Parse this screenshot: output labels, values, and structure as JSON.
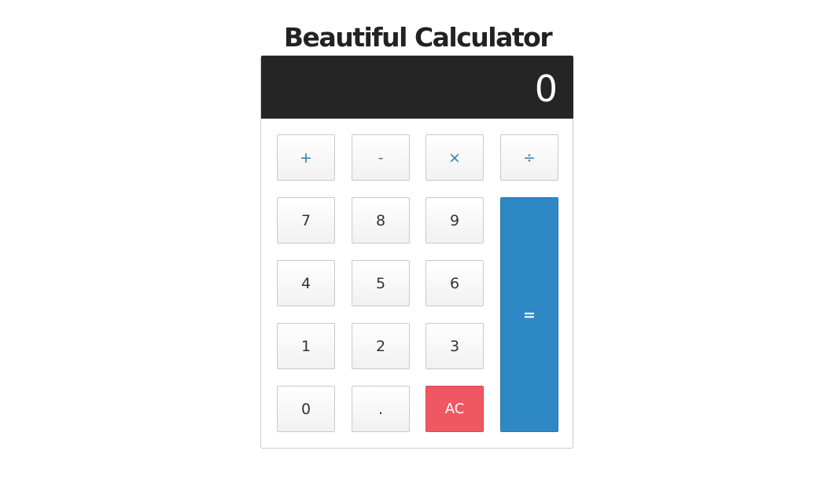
{
  "page": {
    "title": "Beautiful Calculator"
  },
  "calculator": {
    "display_value": "0",
    "keys": {
      "add": "+",
      "subtract": "-",
      "multiply": "×",
      "divide": "÷",
      "seven": "7",
      "eight": "8",
      "nine": "9",
      "four": "4",
      "five": "5",
      "six": "6",
      "one": "1",
      "two": "2",
      "three": "3",
      "zero": "0",
      "decimal": ".",
      "clear": "AC",
      "equal": "="
    }
  },
  "colors": {
    "display_bg": "#252525",
    "operator_text": "#2a7fb8",
    "clear_bg": "#ef5763",
    "equal_bg": "#2e88c4"
  }
}
